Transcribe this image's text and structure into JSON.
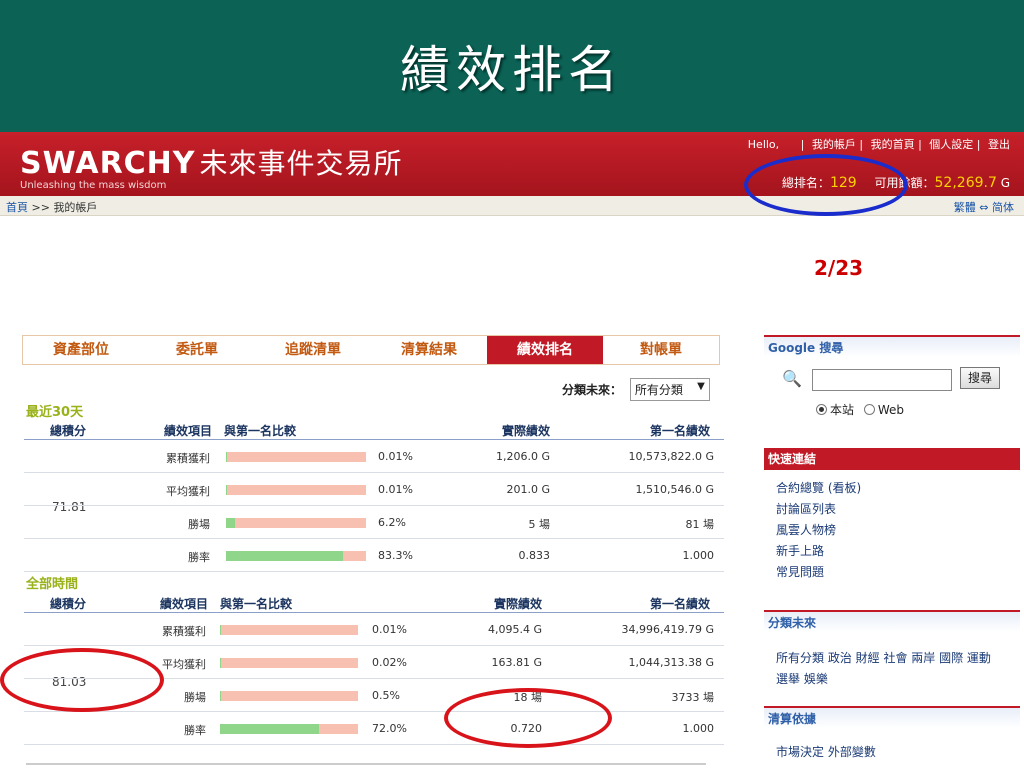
{
  "slide": {
    "title": "績效排名",
    "page": "2/23"
  },
  "header": {
    "logo_main": "SWARCHY",
    "logo_cn": "未來事件交易所",
    "logo_sub": "Unleashing the mass wisdom",
    "hello": "Hello,",
    "links": [
      "我的帳戶",
      "我的首頁",
      "個人設定",
      "登出"
    ],
    "rank_label": "總排名：",
    "rank_value": "129",
    "balance_label": "可用餘額：",
    "balance_value": "52,269.7",
    "balance_unit": "G"
  },
  "breadcrumb": {
    "home": "首頁",
    "sep": ">>",
    "current": "我的帳戶",
    "lang": "繁體 ⇔ 简体"
  },
  "tabs": [
    "資產部位",
    "委託單",
    "追蹤清單",
    "清算結果",
    "績效排名",
    "對帳單"
  ],
  "filter": {
    "label": "分類未來：",
    "value": "所有分類"
  },
  "recent": {
    "title": "最近30天",
    "headers": {
      "score": "總積分",
      "item": "績效項目",
      "compare": "與第一名比較",
      "actual": "實際績效",
      "top": "第一名績效"
    },
    "score": "71.81",
    "rows": [
      {
        "item": "累積獲利",
        "pct": "0.01%",
        "fill": 0.0001,
        "actual": "1,206.0 G",
        "top": "10,573,822.0 G"
      },
      {
        "item": "平均獲利",
        "pct": "0.01%",
        "fill": 0.0001,
        "actual": "201.0 G",
        "top": "1,510,546.0 G"
      },
      {
        "item": "勝場",
        "pct": "6.2%",
        "fill": 0.062,
        "actual": "5 場",
        "top": "81 場"
      },
      {
        "item": "勝率",
        "pct": "83.3%",
        "fill": 0.833,
        "actual": "0.833",
        "top": "1.000"
      }
    ]
  },
  "all_time": {
    "title": "全部時間",
    "headers": {
      "score": "總積分",
      "item": "績效項目",
      "compare": "與第一名比較",
      "actual": "實際績效",
      "top": "第一名績效"
    },
    "score": "81.03",
    "rows": [
      {
        "item": "累積獲利",
        "pct": "0.01%",
        "fill": 0.0001,
        "actual": "4,095.4 G",
        "top": "34,996,419.79 G"
      },
      {
        "item": "平均獲利",
        "pct": "0.02%",
        "fill": 0.0002,
        "actual": "163.81 G",
        "top": "1,044,313.38 G"
      },
      {
        "item": "勝場",
        "pct": "0.5%",
        "fill": 0.005,
        "actual": "18 場",
        "top": "3733 場"
      },
      {
        "item": "勝率",
        "pct": "72.0%",
        "fill": 0.72,
        "actual": "0.720",
        "top": "1.000"
      }
    ]
  },
  "sidebar": {
    "google": {
      "title": "Google 搜尋",
      "button": "搜尋",
      "option_site": "本站",
      "option_web": "Web"
    },
    "quick_links": {
      "title": "快速連結",
      "items": [
        "合約總覽 (看板)",
        "討論區列表",
        "風雲人物榜",
        "新手上路",
        "常見問題"
      ]
    },
    "categories": {
      "title": "分類未來",
      "text": "所有分類 政治 財經 社會 兩岸 國際 運動 選舉 娛樂"
    },
    "settlement": {
      "title": "清算依據",
      "text": "市場決定 外部變數"
    }
  }
}
